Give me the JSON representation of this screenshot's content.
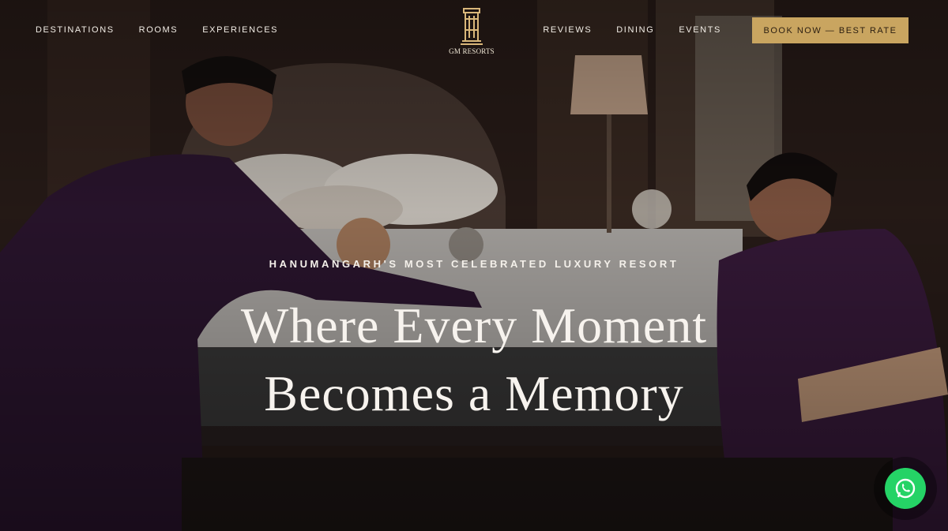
{
  "nav": {
    "left": [
      "DESTINATIONS",
      "ROOMS",
      "EXPERIENCES"
    ],
    "right": [
      "REVIEWS",
      "DINING",
      "EVENTS"
    ],
    "cta": "BOOK NOW — BEST RATE"
  },
  "brand": {
    "logo_text": "GM RESORTS"
  },
  "hero": {
    "eyebrow": "HANUMANGARH'S MOST CELEBRATED LUXURY RESORT",
    "headline_line1": "Where Every Moment",
    "headline_line2": "Becomes a Memory"
  },
  "colors": {
    "accent": "#c9a560",
    "whatsapp": "#25d366",
    "uniform": "#3a1b3d"
  },
  "icons": {
    "whatsapp": "whatsapp-icon"
  }
}
